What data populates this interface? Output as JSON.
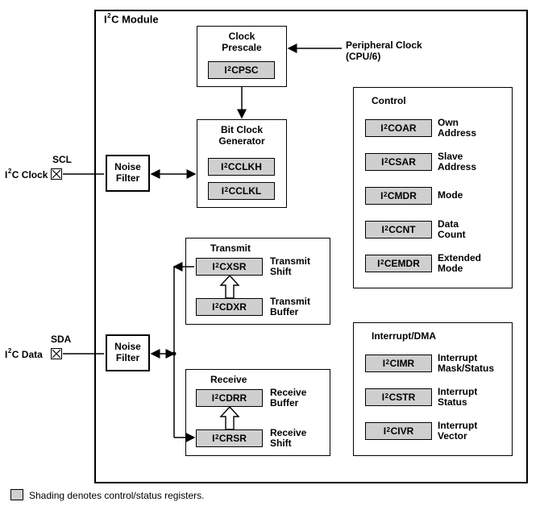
{
  "module": {
    "title_html": "I<sup class='sup'>2</sup>C Module"
  },
  "clock_prescale": {
    "title": "Clock<br>Prescale",
    "reg_html": "I<sup class='sup'>2</sup>CPSC"
  },
  "peripheral_clock": "Peripheral Clock<br>(CPU/6)",
  "bit_clock_gen": {
    "title": "Bit Clock<br>Generator",
    "reg1_html": "I<sup class='sup'>2</sup>CCLKH",
    "reg2_html": "I<sup class='sup'>2</sup>CCLKL"
  },
  "scl": {
    "name": "SCL",
    "sub_html": "I<sup class='sup'>2</sup>C Clock"
  },
  "sda": {
    "name": "SDA",
    "sub_html": "I<sup class='sup'>2</sup>C Data"
  },
  "noise_filter": "Noise<br>Filter",
  "transmit": {
    "title": "Transmit",
    "xsr_html": "I<sup class='sup'>2</sup>CXSR",
    "xsr_label": "Transmit<br>Shift",
    "dxr_html": "I<sup class='sup'>2</sup>CDXR",
    "dxr_label": "Transmit<br>Buffer"
  },
  "receive": {
    "title": "Receive",
    "drr_html": "I<sup class='sup'>2</sup>CDRR",
    "drr_label": "Receive<br>Buffer",
    "rsr_html": "I<sup class='sup'>2</sup>CRSR",
    "rsr_label": "Receive<br>Shift"
  },
  "control": {
    "title": "Control",
    "items": [
      {
        "reg_html": "I<sup class='sup'>2</sup>COAR",
        "label": "Own<br>Address"
      },
      {
        "reg_html": "I<sup class='sup'>2</sup>CSAR",
        "label": "Slave<br>Address"
      },
      {
        "reg_html": "I<sup class='sup'>2</sup>CMDR",
        "label": "Mode"
      },
      {
        "reg_html": "I<sup class='sup'>2</sup>CCNT",
        "label": "Data<br>Count"
      },
      {
        "reg_html": "I<sup class='sup'>2</sup>CEMDR",
        "label": "Extended<br>Mode"
      }
    ]
  },
  "interrupt": {
    "title": "Interrupt/DMA",
    "items": [
      {
        "reg_html": "I<sup class='sup'>2</sup>CIMR",
        "label": "Interrupt<br>Mask/Status"
      },
      {
        "reg_html": "I<sup class='sup'>2</sup>CSTR",
        "label": "Interrupt<br>Status"
      },
      {
        "reg_html": "I<sup class='sup'>2</sup>CIVR",
        "label": "Interrupt<br>Vector"
      }
    ]
  },
  "legend": "Shading denotes control/status registers."
}
